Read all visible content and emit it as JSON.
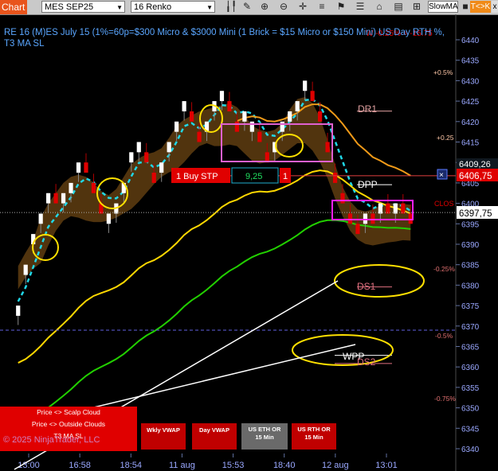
{
  "toolbar": {
    "chart_tab": "Chart",
    "instrument": "MES SEP25",
    "bar_type": "16 Renko",
    "indicator": "SlowMA",
    "tk_label": "T<>K",
    "close_label": "x"
  },
  "info_text": "RE 16  (M)ES July 15 (1%=60p=$300 Micro & $3000 Mini  (1 Brick = $15 Micro or $150 Mini)  US Day RTH %, T3 MA SL",
  "pct_labels": [
    "+0.5%",
    "+0.25",
    "-0.25%",
    "-0.5%",
    "-0.75%",
    "0",
    "W -0.25% = -15.75"
  ],
  "levels": {
    "dr1": "DR1",
    "dpp": "DPP",
    "ds1": "DS1",
    "ds2": "DS2",
    "wpp": "WPP",
    "clos": "CLOS"
  },
  "order": {
    "type": "1  Buy STP",
    "price": "9,25",
    "qty": "1"
  },
  "price_flags": {
    "target": "6409,26",
    "order": "6406,75",
    "last": "6397,75"
  },
  "buttons": {
    "wkly_vwap": "Wkly VWAP",
    "day_vwap": "Day VWAP",
    "eth_or": "US ETH OR 15 Min",
    "rth_or": "US RTH OR 15 Min"
  },
  "legend": {
    "line1": "Price <> Scalp Cloud",
    "line2": "Price <> Outside Clouds",
    "line3": "T3 MA SL"
  },
  "copyright": "© 2025 NinjaTrader, LLC",
  "colors": {
    "up": "#ffffff",
    "down": "#e00000",
    "t3": "#ffd800",
    "slow": "#f09a18",
    "green": "#22d000",
    "cyan": "#20d8e8",
    "cloud": "#5a3a10",
    "axis": "#9aa8ff"
  },
  "chart_data": {
    "type": "renko",
    "brick_size": 2.5,
    "ylim": [
      6340,
      6440
    ],
    "y_ticks": [
      6340,
      6345,
      6350,
      6355,
      6360,
      6365,
      6370,
      6375,
      6380,
      6385,
      6390,
      6395,
      6400,
      6405,
      6410,
      6415,
      6420,
      6425,
      6430,
      6435,
      6440
    ],
    "x_ticks": [
      "13:00",
      "16:58",
      "18:54",
      "11 aug",
      "15:53",
      "18:40",
      "12 aug",
      "13:01"
    ],
    "bricks": [
      [
        "u",
        6375
      ],
      [
        "u",
        6385
      ],
      [
        "u",
        6392.5
      ],
      [
        "u",
        6397.5
      ],
      [
        "u",
        6402.5
      ],
      [
        "d",
        6400
      ],
      [
        "u",
        6402.5
      ],
      [
        "u",
        6405
      ],
      [
        "u",
        6410
      ],
      [
        "d",
        6407.5
      ],
      [
        "d",
        6402.5
      ],
      [
        "d",
        6397.5
      ],
      [
        "u",
        6397.5
      ],
      [
        "u",
        6400
      ],
      [
        "u",
        6405
      ],
      [
        "u",
        6412.5
      ],
      [
        "u",
        6415
      ],
      [
        "d",
        6410
      ],
      [
        "d",
        6405
      ],
      [
        "u",
        6410
      ],
      [
        "u",
        6415
      ],
      [
        "u",
        6420
      ],
      [
        "u",
        6425
      ],
      [
        "d",
        6420
      ],
      [
        "d",
        6415
      ],
      [
        "u",
        6420
      ],
      [
        "u",
        6425
      ],
      [
        "u",
        6427.5
      ],
      [
        "d",
        6422.5
      ],
      [
        "d",
        6417.5
      ],
      [
        "u",
        6422.5
      ],
      [
        "u",
        6420
      ],
      [
        "d",
        6415
      ],
      [
        "d",
        6410
      ],
      [
        "u",
        6415
      ],
      [
        "u",
        6420
      ],
      [
        "u",
        6422.5
      ],
      [
        "u",
        6425
      ],
      [
        "u",
        6430
      ],
      [
        "d",
        6425
      ],
      [
        "d",
        6420
      ],
      [
        "d",
        6412.5
      ],
      [
        "d",
        6405
      ],
      [
        "d",
        6400
      ],
      [
        "d",
        6395
      ],
      [
        "d",
        6392.5
      ],
      [
        "u",
        6397.5
      ],
      [
        "d",
        6395
      ],
      [
        "u",
        6400
      ],
      [
        "d",
        6397.5
      ],
      [
        "u",
        6400
      ],
      [
        "d",
        6397.5
      ],
      [
        "d",
        6395
      ]
    ],
    "levels": {
      "dr1": 6421,
      "dpp": 6403,
      "ds1": 6378,
      "ds2": 6362,
      "wpp": 6364,
      "order": 6406.75,
      "last": 6397.75,
      "target": 6409.26,
      "pct_-0.5": 6369
    }
  }
}
